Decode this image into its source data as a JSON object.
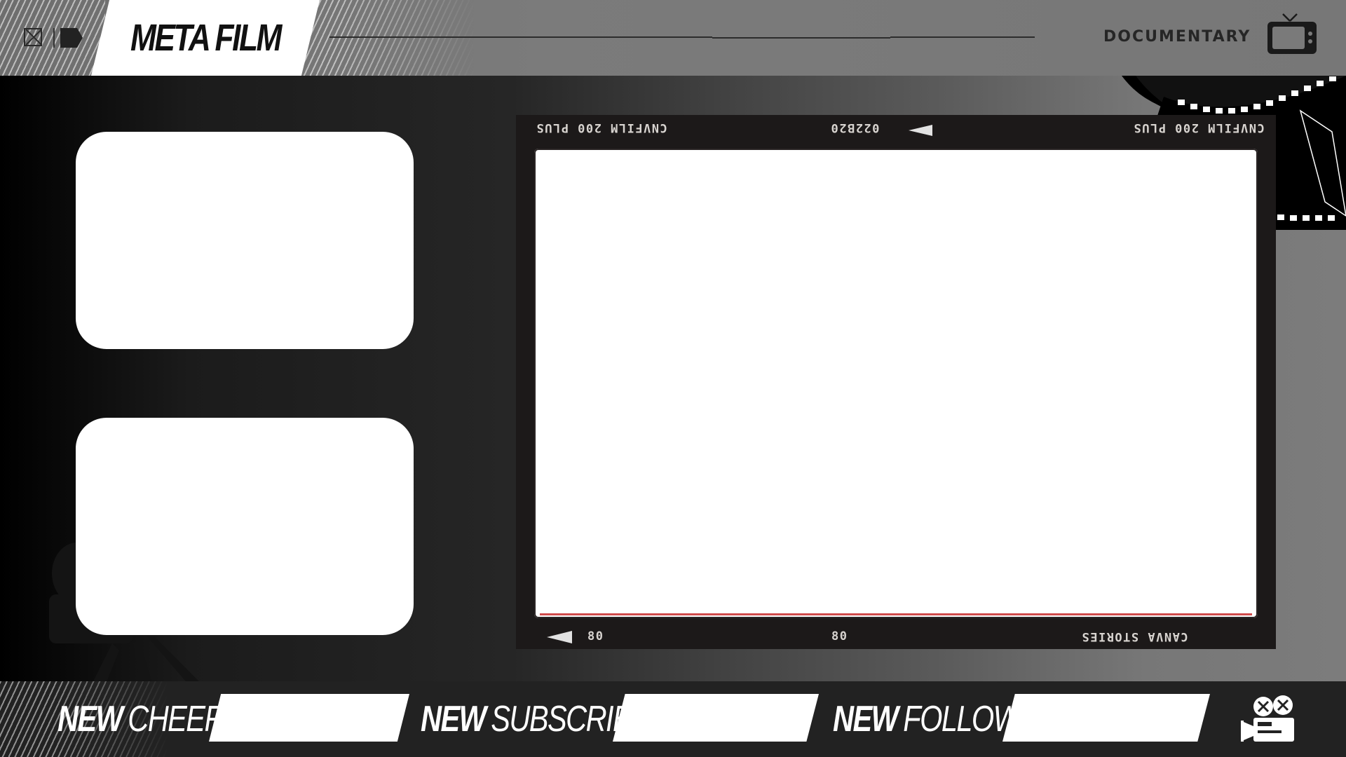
{
  "header": {
    "title": "META FILM",
    "category": "DOCUMENTARY"
  },
  "film_frame": {
    "top_left_text": "CNVFILM 200 PLUS",
    "top_mid_text": "022B20",
    "top_right_text": "CNVFILM 200 PLUS",
    "bottom_left_text": "80",
    "bottom_mid_text": "80",
    "bottom_right_text": "CANVA STORIES"
  },
  "alerts": [
    {
      "strong": "NEW",
      "light": "CHEERER"
    },
    {
      "strong": "NEW",
      "light": "SUBSCRIBER"
    },
    {
      "strong": "NEW",
      "light": "FOLLOWER"
    }
  ],
  "colors": {
    "frame_dark": "#1c1919",
    "accent_red": "#c72b2b",
    "slot_white": "#ffffff"
  }
}
